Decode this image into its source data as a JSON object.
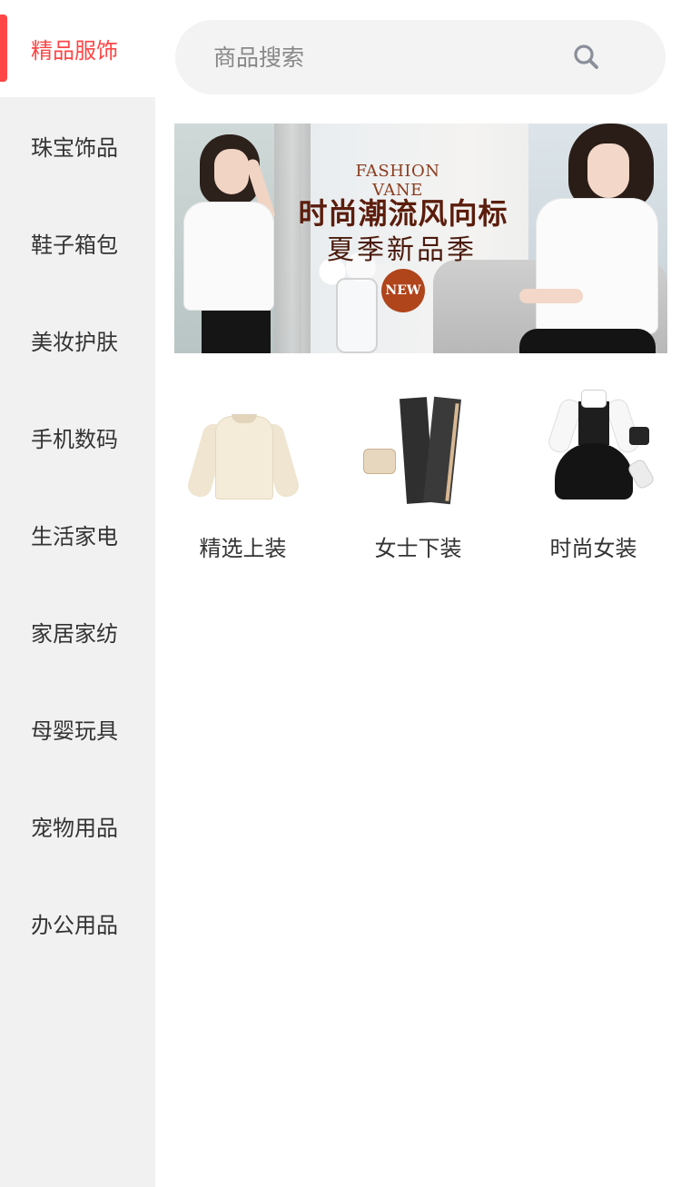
{
  "sidebar": {
    "items": [
      {
        "label": "精品服饰",
        "active": true
      },
      {
        "label": "珠宝饰品",
        "active": false
      },
      {
        "label": "鞋子箱包",
        "active": false
      },
      {
        "label": "美妆护肤",
        "active": false
      },
      {
        "label": "手机数码",
        "active": false
      },
      {
        "label": "生活家电",
        "active": false
      },
      {
        "label": "家居家纺",
        "active": false
      },
      {
        "label": "母婴玩具",
        "active": false
      },
      {
        "label": "宠物用品",
        "active": false
      },
      {
        "label": "办公用品",
        "active": false
      }
    ],
    "accent_color": "#ff4545",
    "background_color": "#f1f1f1"
  },
  "search": {
    "placeholder": "商品搜索",
    "value": "",
    "icon": "search-icon"
  },
  "banner": {
    "english_text": "FASHION VANE",
    "headline": "时尚潮流风向标",
    "subheadline": "夏季新品季",
    "badge": "NEW"
  },
  "categories": [
    {
      "label": "精选上装",
      "image": "sweater-image"
    },
    {
      "label": "女士下装",
      "image": "pants-image"
    },
    {
      "label": "时尚女装",
      "image": "dress-image"
    }
  ]
}
